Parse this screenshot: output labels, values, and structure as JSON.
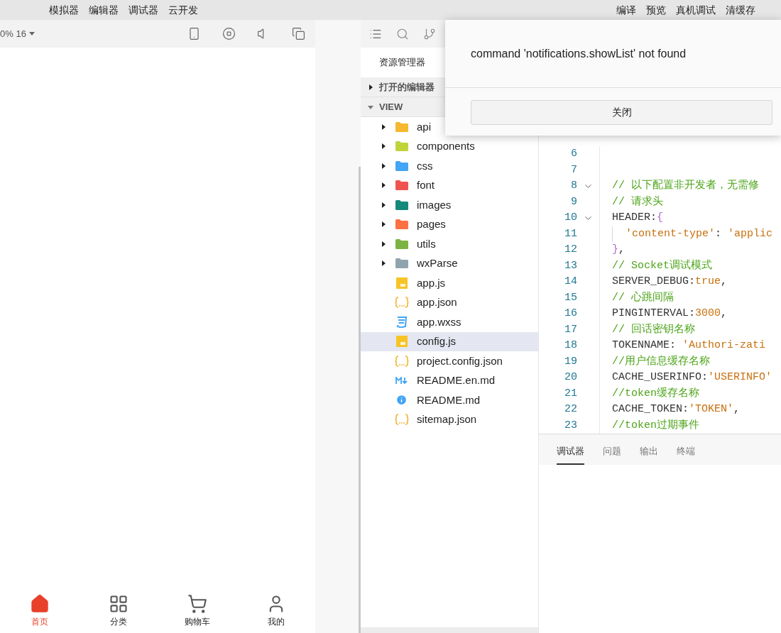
{
  "menu_left": [
    "模拟器",
    "编辑器",
    "调试器",
    "云开发"
  ],
  "menu_right": [
    "编译",
    "预览",
    "真机调试",
    "清缓存"
  ],
  "simulator": {
    "zoom": "0% 16",
    "tabbar": [
      {
        "label": "首页",
        "selected": true
      },
      {
        "label": "分类",
        "selected": false
      },
      {
        "label": "购物车",
        "selected": false
      },
      {
        "label": "我的",
        "selected": false
      }
    ]
  },
  "explorer": {
    "title": "资源管理器",
    "sections": [
      {
        "label": "打开的编辑器",
        "expanded": false
      },
      {
        "label": "VIEW",
        "expanded": true
      }
    ],
    "tree": [
      {
        "name": "api",
        "kind": "folder",
        "color": "#f5b82e",
        "expanded": false,
        "selected": false
      },
      {
        "name": "components",
        "kind": "folder",
        "color": "#c0d43a",
        "expanded": false,
        "selected": false
      },
      {
        "name": "css",
        "kind": "folder",
        "color": "#42a5f5",
        "expanded": false,
        "selected": false
      },
      {
        "name": "font",
        "kind": "folder",
        "color": "#ef5350",
        "expanded": false,
        "selected": false
      },
      {
        "name": "images",
        "kind": "folder",
        "color": "#15897a",
        "expanded": false,
        "selected": false
      },
      {
        "name": "pages",
        "kind": "folder",
        "color": "#ff7043",
        "expanded": false,
        "selected": false
      },
      {
        "name": "utils",
        "kind": "folder",
        "color": "#7cb342",
        "expanded": false,
        "selected": false
      },
      {
        "name": "wxParse",
        "kind": "folder",
        "color": "#90a4ae",
        "expanded": false,
        "selected": false
      },
      {
        "name": "app.js",
        "kind": "js",
        "selected": false
      },
      {
        "name": "app.json",
        "kind": "json",
        "selected": false
      },
      {
        "name": "app.wxss",
        "kind": "css",
        "selected": false
      },
      {
        "name": "config.js",
        "kind": "js",
        "selected": true
      },
      {
        "name": "project.config.json",
        "kind": "json",
        "selected": false
      },
      {
        "name": "README.en.md",
        "kind": "md",
        "selected": false
      },
      {
        "name": "README.md",
        "kind": "info",
        "selected": false
      },
      {
        "name": "sitemap.json",
        "kind": "json",
        "selected": false
      }
    ]
  },
  "editor": {
    "lines": [
      {
        "number": "6",
        "foldable": false
      },
      {
        "number": "7",
        "foldable": false
      },
      {
        "number": "8",
        "foldable": true,
        "tokens": [
          {
            "kind": "comment",
            "text": "// 以下配置非开发者，无需修"
          }
        ]
      },
      {
        "number": "9",
        "foldable": false,
        "tokens": [
          {
            "kind": "comment",
            "text": "// 请求头"
          }
        ]
      },
      {
        "number": "10",
        "foldable": true,
        "tokens": [
          {
            "kind": "key",
            "text": "HEADER:"
          },
          {
            "kind": "brace",
            "text": "{"
          }
        ]
      },
      {
        "number": "11",
        "foldable": false,
        "guide": true,
        "tokens": [
          {
            "kind": "string",
            "text": "'content-type'"
          },
          {
            "kind": "key",
            "text": ": "
          },
          {
            "kind": "string",
            "text": "'applic"
          }
        ]
      },
      {
        "number": "12",
        "foldable": false,
        "tokens": [
          {
            "kind": "brace",
            "text": "}"
          },
          {
            "kind": "key",
            "text": ","
          }
        ]
      },
      {
        "number": "13",
        "foldable": false,
        "tokens": [
          {
            "kind": "comment",
            "text": "// Socket调试模式"
          }
        ]
      },
      {
        "number": "14",
        "foldable": false,
        "tokens": [
          {
            "kind": "key",
            "text": "SERVER_DEBUG:"
          },
          {
            "kind": "string",
            "text": "true"
          },
          {
            "kind": "key",
            "text": ","
          }
        ]
      },
      {
        "number": "15",
        "foldable": false,
        "tokens": [
          {
            "kind": "comment",
            "text": "// 心跳间隔"
          }
        ]
      },
      {
        "number": "16",
        "foldable": false,
        "tokens": [
          {
            "kind": "key",
            "text": "PINGINTERVAL:"
          },
          {
            "kind": "string",
            "text": "3000"
          },
          {
            "kind": "key",
            "text": ","
          }
        ]
      },
      {
        "number": "17",
        "foldable": false,
        "tokens": [
          {
            "kind": "comment",
            "text": "// 回话密钥名称"
          }
        ]
      },
      {
        "number": "18",
        "foldable": false,
        "tokens": [
          {
            "kind": "key",
            "text": "TOKENNAME: "
          },
          {
            "kind": "string",
            "text": "'Authori-zati"
          }
        ]
      },
      {
        "number": "19",
        "foldable": false,
        "tokens": [
          {
            "kind": "comment",
            "text": "//用户信息缓存名称"
          }
        ]
      },
      {
        "number": "20",
        "foldable": false,
        "tokens": [
          {
            "kind": "key",
            "text": "CACHE_USERINFO:"
          },
          {
            "kind": "string",
            "text": "'USERINFO'"
          }
        ]
      },
      {
        "number": "21",
        "foldable": false,
        "tokens": [
          {
            "kind": "comment",
            "text": "//token缓存名称"
          }
        ]
      },
      {
        "number": "22",
        "foldable": false,
        "tokens": [
          {
            "kind": "key",
            "text": "CACHE_TOKEN:"
          },
          {
            "kind": "string",
            "text": "'TOKEN'"
          },
          {
            "kind": "key",
            "text": ","
          }
        ]
      },
      {
        "number": "23",
        "foldable": false,
        "tokens": [
          {
            "kind": "comment",
            "text": "//token过期事件"
          }
        ]
      }
    ]
  },
  "panel_tabs": [
    {
      "label": "调试器",
      "selected": true
    },
    {
      "label": "问题",
      "selected": false
    },
    {
      "label": "输出",
      "selected": false
    },
    {
      "label": "终端",
      "selected": false
    }
  ],
  "dialog": {
    "message": "command 'notifications.showList' not found",
    "button": "关闭"
  }
}
